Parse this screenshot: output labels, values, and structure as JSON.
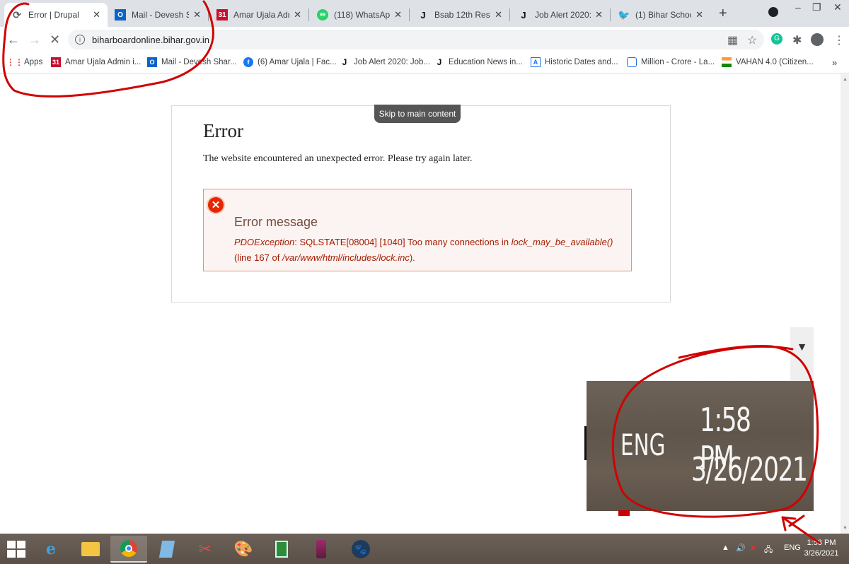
{
  "browser": {
    "tabs": [
      {
        "title": "Error | Drupal",
        "active": true
      },
      {
        "title": "Mail - Devesh Sha",
        "active": false
      },
      {
        "title": "Amar Ujala Admin",
        "active": false
      },
      {
        "title": "(118) WhatsApp",
        "active": false
      },
      {
        "title": "Bsab 12th Result 2",
        "active": false
      },
      {
        "title": "Job Alert 2020: Jo",
        "active": false
      },
      {
        "title": "(1) Bihar School E",
        "active": false
      }
    ],
    "new_tab": "+",
    "url": "biharboardonline.bihar.gov.in",
    "bookmarks": [
      {
        "label": "Apps"
      },
      {
        "label": "Amar Ujala Admin i..."
      },
      {
        "label": "Mail - Devesh Shar..."
      },
      {
        "label": "(6) Amar Ujala | Fac..."
      },
      {
        "label": "Job Alert 2020: Job..."
      },
      {
        "label": "Education News in..."
      },
      {
        "label": "Historic Dates and..."
      },
      {
        "label": "Million - Crore - La..."
      },
      {
        "label": "VAHAN 4.0 (Citizen..."
      }
    ],
    "bookmarks_more": "»"
  },
  "page": {
    "skip_link": "Skip to main content",
    "title": "Error",
    "description": "The website encountered an unexpected error. Please try again later.",
    "message_heading": "Error message",
    "exception": "PDOException",
    "message_mid": ": SQLSTATE[08004] [1040] Too many connections in ",
    "function": "lock_may_be_available()",
    "message_tail": " (line 167 of ",
    "file": "/var/www/html/includes/lock.inc",
    "message_end": ")."
  },
  "zoom": {
    "lang": "ENG",
    "time": "1:58 PM",
    "date": "3/26/2021"
  },
  "taskbar": {
    "lang": "ENG",
    "time": "1:58 PM",
    "date": "3/26/2021"
  },
  "colors": {
    "annotation": "#d10000",
    "error_red": "#e62600",
    "message_bg": "#fcf4f2"
  }
}
